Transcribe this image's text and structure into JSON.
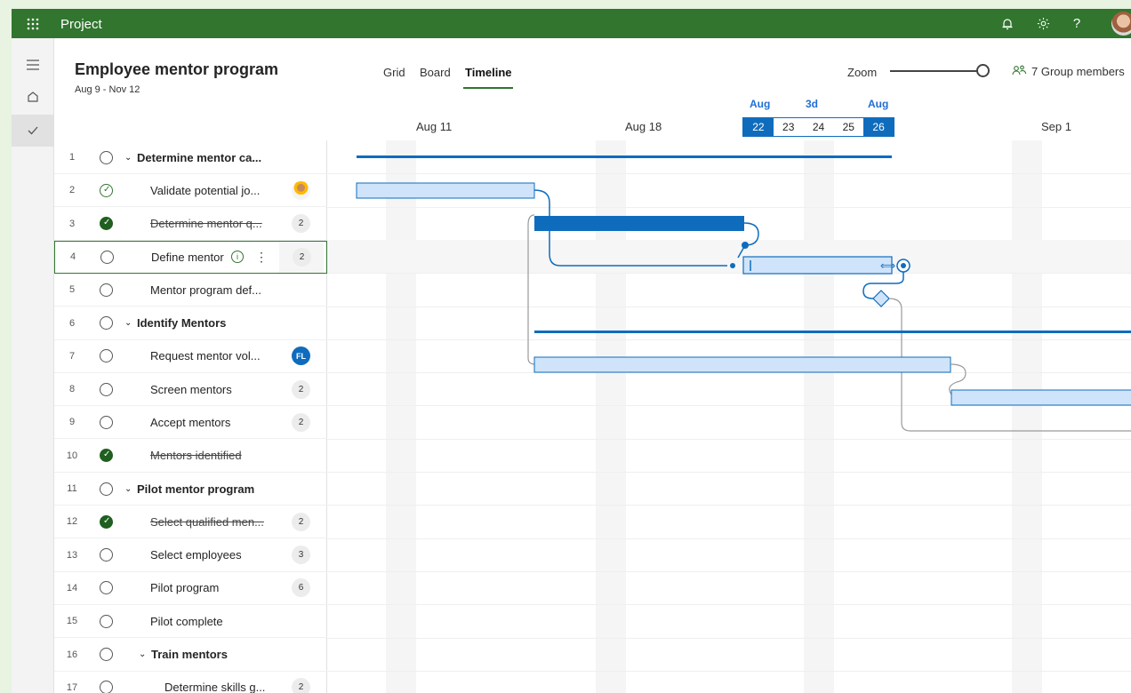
{
  "topbar": {
    "app_name": "Project",
    "icons": [
      "waffle-icon",
      "bell-icon",
      "gear-icon",
      "help-icon"
    ],
    "help_glyph": "?"
  },
  "rail": {
    "icons": [
      "hamburger-icon",
      "home-icon",
      "check-icon"
    ]
  },
  "header": {
    "title": "Employee mentor program",
    "dates": "Aug 9 - Nov 12",
    "tabs": [
      "Grid",
      "Board",
      "Timeline"
    ],
    "active_tab": "Timeline",
    "zoom_label": "Zoom",
    "zoom_level": 1.0,
    "members": "7 Group members"
  },
  "timeline": {
    "weeks": [
      "Aug 11",
      "Aug 18",
      "Sep 1"
    ],
    "selection": {
      "month_left": "Aug",
      "span": "3d",
      "month_right": "Aug",
      "days": [
        "22",
        "23",
        "24",
        "25",
        "26"
      ],
      "highlight": [
        "22",
        "26"
      ]
    }
  },
  "tasks": [
    {
      "num": "1",
      "name": "Determine mentor ca...",
      "summary": true,
      "status": "open",
      "badge": ""
    },
    {
      "num": "2",
      "name": "Validate potential jo...",
      "summary": false,
      "status": "partial",
      "badge": "photo"
    },
    {
      "num": "3",
      "name": "Determine mentor q...",
      "summary": false,
      "status": "done",
      "badge": "2"
    },
    {
      "num": "4",
      "name": "Define mentor",
      "summary": false,
      "status": "open",
      "badge": "2",
      "selected": true
    },
    {
      "num": "5",
      "name": "Mentor program def...",
      "summary": false,
      "status": "open",
      "badge": ""
    },
    {
      "num": "6",
      "name": "Identify Mentors",
      "summary": true,
      "status": "open",
      "badge": ""
    },
    {
      "num": "7",
      "name": "Request mentor vol...",
      "summary": false,
      "status": "open",
      "badge": "FL"
    },
    {
      "num": "8",
      "name": "Screen mentors",
      "summary": false,
      "status": "open",
      "badge": "2"
    },
    {
      "num": "9",
      "name": "Accept mentors",
      "summary": false,
      "status": "open",
      "badge": "2"
    },
    {
      "num": "10",
      "name": "Mentors identified",
      "summary": false,
      "status": "done",
      "badge": ""
    },
    {
      "num": "11",
      "name": "Pilot mentor program",
      "summary": true,
      "status": "open",
      "badge": ""
    },
    {
      "num": "12",
      "name": "Select qualified men...",
      "summary": false,
      "status": "done",
      "badge": "2"
    },
    {
      "num": "13",
      "name": "Select employees",
      "summary": false,
      "status": "open",
      "badge": "3"
    },
    {
      "num": "14",
      "name": "Pilot program",
      "summary": false,
      "status": "open",
      "badge": "6"
    },
    {
      "num": "15",
      "name": "Pilot complete",
      "summary": false,
      "status": "open",
      "badge": ""
    },
    {
      "num": "16",
      "name": "Train mentors",
      "summary": true,
      "status": "open",
      "badge": "",
      "indent": 1
    },
    {
      "num": "17",
      "name": "Determine skills g...",
      "summary": false,
      "status": "open",
      "badge": "2",
      "indent": 1
    }
  ],
  "colors": {
    "brand": "#31752f",
    "accent": "#0f6cbd",
    "bar_light": "#cfe4fa"
  }
}
